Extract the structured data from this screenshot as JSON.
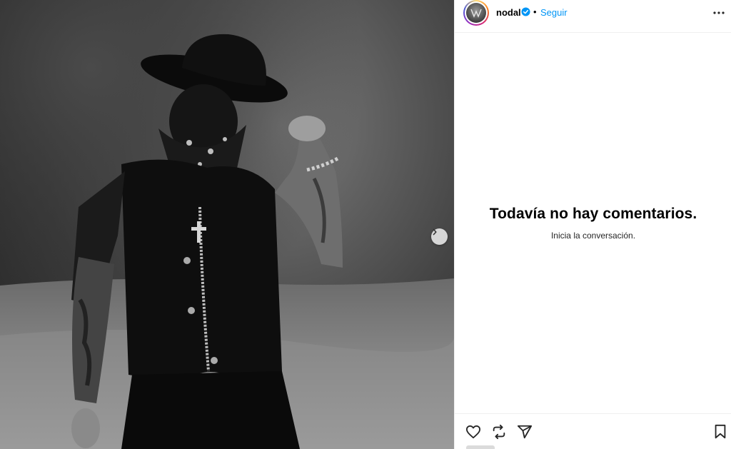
{
  "post": {
    "image_alt": "",
    "next_label": "›"
  },
  "header": {
    "username": "nodal",
    "separator": "•",
    "follow_label": "Seguir",
    "more_label": "..."
  },
  "comments": {
    "empty_title": "Todavía no hay comentarios.",
    "empty_subtitle": "Inicia la conversación."
  },
  "actions": {
    "icons": [
      "heart-icon",
      "repost-icon",
      "share-icon",
      "bookmark-icon"
    ]
  },
  "colors": {
    "follow": "#0095f6",
    "verified": "#0095f6",
    "border": "#efefef"
  }
}
